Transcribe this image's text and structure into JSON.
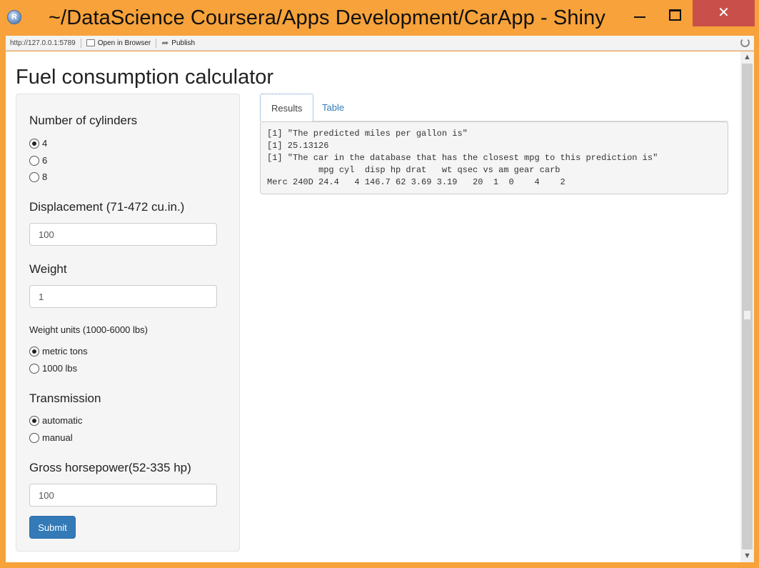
{
  "window": {
    "title": "~/DataScience Coursera/Apps Development/CarApp - Shiny",
    "app_icon": "R",
    "close_glyph": "✕"
  },
  "toolbar": {
    "url": "http://127.0.0.1:5789",
    "open_label": "Open in Browser",
    "publish_label": "Publish"
  },
  "page": {
    "title": "Fuel consumption calculator"
  },
  "sidebar": {
    "cylinders": {
      "label": "Number of cylinders",
      "options": [
        "4",
        "6",
        "8"
      ],
      "selected": "4"
    },
    "displacement": {
      "label": "Displacement (71-472 cu.in.)",
      "value": "100"
    },
    "weight": {
      "label": "Weight",
      "value": "1"
    },
    "weight_units": {
      "label": "Weight units (1000-6000 lbs)",
      "options": [
        "metric tons",
        "1000 lbs"
      ],
      "selected": "metric tons"
    },
    "transmission": {
      "label": "Transmission",
      "options": [
        "automatic",
        "manual"
      ],
      "selected": "automatic"
    },
    "horsepower": {
      "label": "Gross horsepower(52-335 hp)",
      "value": "100"
    },
    "submit_label": "Submit"
  },
  "main": {
    "tabs": [
      {
        "label": "Results",
        "active": true
      },
      {
        "label": "Table",
        "active": false
      }
    ],
    "output_lines": [
      "[1] \"The predicted miles per gallon is\"",
      "[1] 25.13126",
      "[1] \"The car in the database that has the closest mpg to this prediction is\"",
      "          mpg cyl  disp hp drat   wt qsec vs am gear carb",
      "Merc 240D 24.4   4 146.7 62 3.69 3.19   20  1  0    4    2"
    ]
  },
  "colors": {
    "frame": "#f7a23a",
    "close": "#c9504a",
    "primary_button": "#337ab7",
    "tab_link": "#337ab7"
  },
  "icons": [
    "r-app-icon",
    "minimize-icon",
    "maximize-icon",
    "close-icon",
    "open-browser-icon",
    "publish-icon",
    "refresh-icon",
    "scroll-up-icon",
    "scroll-down-icon"
  ]
}
